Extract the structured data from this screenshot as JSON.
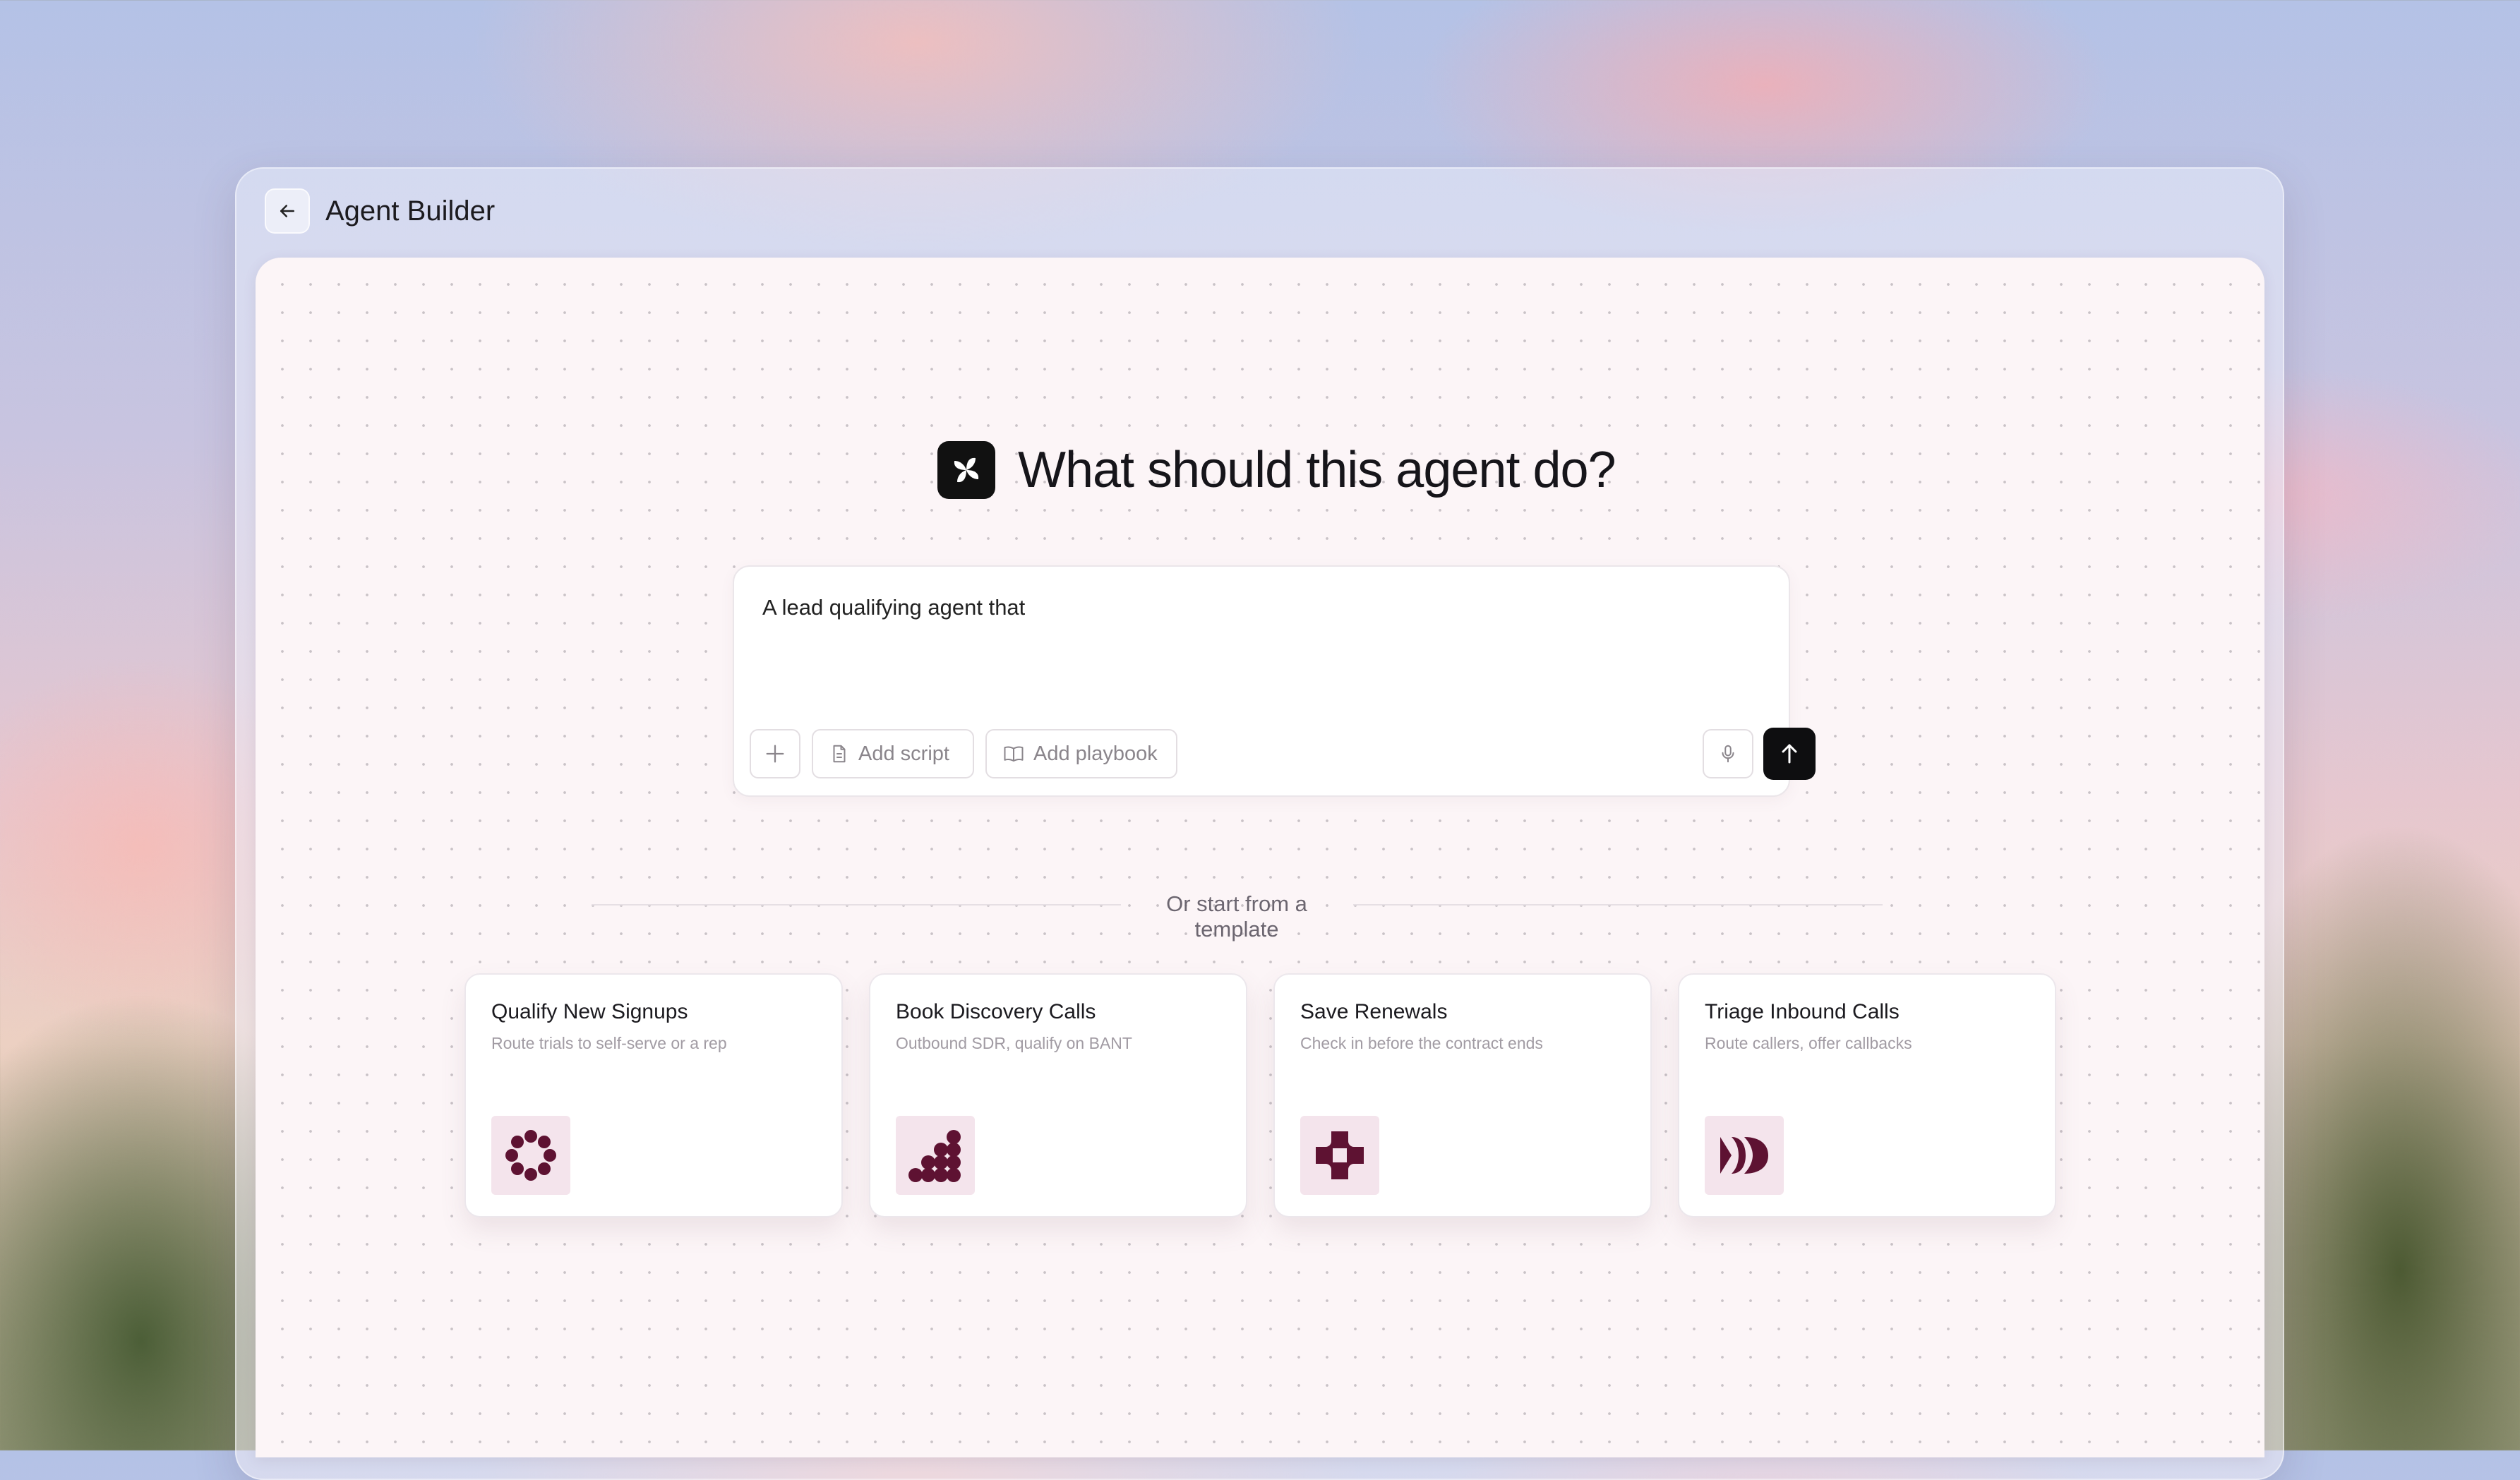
{
  "window": {
    "title": "Agent Builder"
  },
  "main": {
    "headline": "What should this agent do?",
    "prompt": {
      "value": "A lead qualifying agent that",
      "add_script_label": "Add script",
      "add_playbook_label": "Add playbook"
    },
    "templates_label": "Or start from a template",
    "templates": [
      {
        "title": "Qualify New Signups",
        "subtitle": "Route trials to self-serve or a rep",
        "icon": "dot-ring-icon"
      },
      {
        "title": "Book Discovery Calls",
        "subtitle": "Outbound SDR, qualify on BANT",
        "icon": "dot-staircase-icon"
      },
      {
        "title": "Save Renewals",
        "subtitle": "Check in before the contract ends",
        "icon": "lifebuoy-icon"
      },
      {
        "title": "Triage Inbound Calls",
        "subtitle": "Route callers, offer callbacks",
        "icon": "arrow-forward-shapes-icon"
      }
    ]
  },
  "colors": {
    "accent": "#5e1232",
    "icon_bg": "#f4e4ec",
    "send_bg": "#0e0e10"
  }
}
